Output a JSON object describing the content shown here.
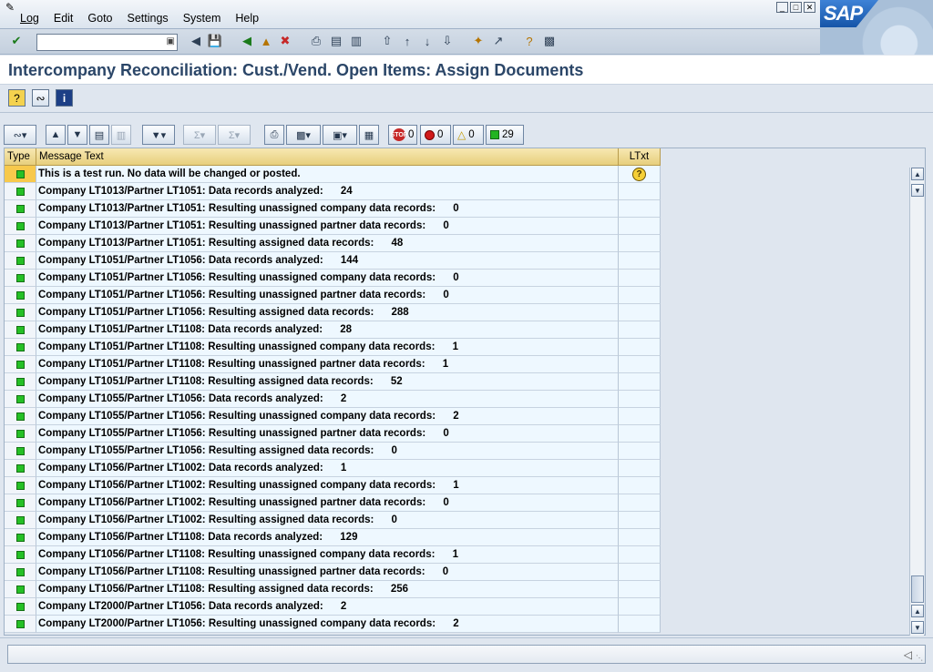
{
  "menu": {
    "items": [
      "Log",
      "Edit",
      "Goto",
      "Settings",
      "System",
      "Help"
    ]
  },
  "logo": "SAP",
  "command_field": {
    "value": ""
  },
  "title": "Intercompany Reconciliation: Cust./Vend. Open Items: Assign Documents",
  "alv": {
    "counters": {
      "stop": "0",
      "error": "0",
      "warning": "0",
      "success": "29"
    },
    "columns": [
      "Type",
      "Message Text",
      "LTxt"
    ],
    "rows": [
      {
        "status": "warning",
        "text": "This is a test run. No data will be changed or posted.",
        "ltxt": "help"
      },
      {
        "status": "success",
        "text": "Company LT1013/Partner LT1051: Data records analyzed:      24"
      },
      {
        "status": "success",
        "text": "Company LT1013/Partner LT1051: Resulting unassigned company data records:      0"
      },
      {
        "status": "success",
        "text": "Company LT1013/Partner LT1051: Resulting unassigned partner data records:      0"
      },
      {
        "status": "success",
        "text": "Company LT1013/Partner LT1051: Resulting assigned data records:      48"
      },
      {
        "status": "success",
        "text": "Company LT1051/Partner LT1056: Data records analyzed:      144"
      },
      {
        "status": "success",
        "text": "Company LT1051/Partner LT1056: Resulting unassigned company data records:      0"
      },
      {
        "status": "success",
        "text": "Company LT1051/Partner LT1056: Resulting unassigned partner data records:      0"
      },
      {
        "status": "success",
        "text": "Company LT1051/Partner LT1056: Resulting assigned data records:      288"
      },
      {
        "status": "success",
        "text": "Company LT1051/Partner LT1108: Data records analyzed:      28"
      },
      {
        "status": "success",
        "text": "Company LT1051/Partner LT1108: Resulting unassigned company data records:      1"
      },
      {
        "status": "success",
        "text": "Company LT1051/Partner LT1108: Resulting unassigned partner data records:      1"
      },
      {
        "status": "success",
        "text": "Company LT1051/Partner LT1108: Resulting assigned data records:      52"
      },
      {
        "status": "success",
        "text": "Company LT1055/Partner LT1056: Data records analyzed:      2"
      },
      {
        "status": "success",
        "text": "Company LT1055/Partner LT1056: Resulting unassigned company data records:      2"
      },
      {
        "status": "success",
        "text": "Company LT1055/Partner LT1056: Resulting unassigned partner data records:      0"
      },
      {
        "status": "success",
        "text": "Company LT1055/Partner LT1056: Resulting assigned data records:      0"
      },
      {
        "status": "success",
        "text": "Company LT1056/Partner LT1002: Data records analyzed:      1"
      },
      {
        "status": "success",
        "text": "Company LT1056/Partner LT1002: Resulting unassigned company data records:      1"
      },
      {
        "status": "success",
        "text": "Company LT1056/Partner LT1002: Resulting unassigned partner data records:      0"
      },
      {
        "status": "success",
        "text": "Company LT1056/Partner LT1002: Resulting assigned data records:      0"
      },
      {
        "status": "success",
        "text": "Company LT1056/Partner LT1108: Data records analyzed:      129"
      },
      {
        "status": "success",
        "text": "Company LT1056/Partner LT1108: Resulting unassigned company data records:      1"
      },
      {
        "status": "success",
        "text": "Company LT1056/Partner LT1108: Resulting unassigned partner data records:      0"
      },
      {
        "status": "success",
        "text": "Company LT1056/Partner LT1108: Resulting assigned data records:      256"
      },
      {
        "status": "success",
        "text": "Company LT2000/Partner LT1056: Data records analyzed:      2"
      },
      {
        "status": "success",
        "text": "Company LT2000/Partner LT1056: Resulting unassigned company data records:      2"
      }
    ]
  },
  "statusbar": {
    "message": ""
  },
  "colors": {
    "accent": "#2b4668",
    "header": "#e7cf7c",
    "row_bg": "#eef8ff",
    "success": "#25c025",
    "warning": "#f7c94c"
  }
}
